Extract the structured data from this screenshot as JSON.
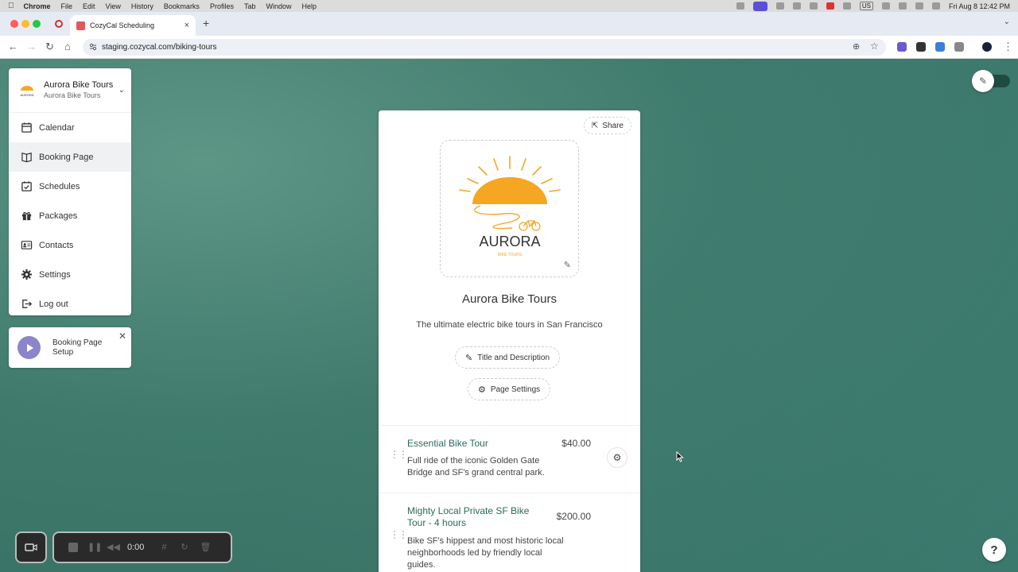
{
  "menubar": {
    "app": "Chrome",
    "items": [
      "File",
      "Edit",
      "View",
      "History",
      "Bookmarks",
      "Profiles",
      "Tab",
      "Window",
      "Help"
    ],
    "clock": "Fri Aug 8  12:42 PM",
    "keyboard": "US"
  },
  "browser": {
    "tab_title": "CozyCal Scheduling",
    "url": "staging.cozycal.com/biking-tours"
  },
  "sidebar": {
    "business_name": "Aurora Bike Tours",
    "business_sub": "Aurora Bike Tours",
    "items": [
      {
        "label": "Calendar",
        "icon": "calendar-icon"
      },
      {
        "label": "Booking Page",
        "icon": "book-icon",
        "active": true
      },
      {
        "label": "Schedules",
        "icon": "calendar-check-icon"
      },
      {
        "label": "Packages",
        "icon": "gift-icon"
      },
      {
        "label": "Contacts",
        "icon": "contact-card-icon"
      },
      {
        "label": "Settings",
        "icon": "gear-icon"
      },
      {
        "label": "Log out",
        "icon": "logout-icon"
      }
    ]
  },
  "setup_card": {
    "label": "Booking Page Setup"
  },
  "booking": {
    "share_label": "Share",
    "logo_text": "AURORA",
    "logo_sub": "BIKE TOURS",
    "title": "Aurora Bike Tours",
    "description": "The ultimate electric bike tours in San Francisco",
    "title_desc_button": "Title and Description",
    "page_settings_button": "Page Settings",
    "services": [
      {
        "name": "Essential Bike Tour",
        "price": "$40.00",
        "description": "Full ride of the iconic Golden Gate Bridge and SF's grand central park."
      },
      {
        "name": "Mighty Local Private SF Bike Tour - 4 hours",
        "price": "$200.00",
        "description": "Bike SF's hippest and most historic local neighborhoods led by friendly local guides."
      }
    ]
  },
  "recorder": {
    "time": "0:00"
  },
  "help": {
    "label": "?"
  },
  "colors": {
    "accent": "#2b6a5c",
    "logo_yellow": "#f5a623",
    "background": "#3f7a6c"
  }
}
